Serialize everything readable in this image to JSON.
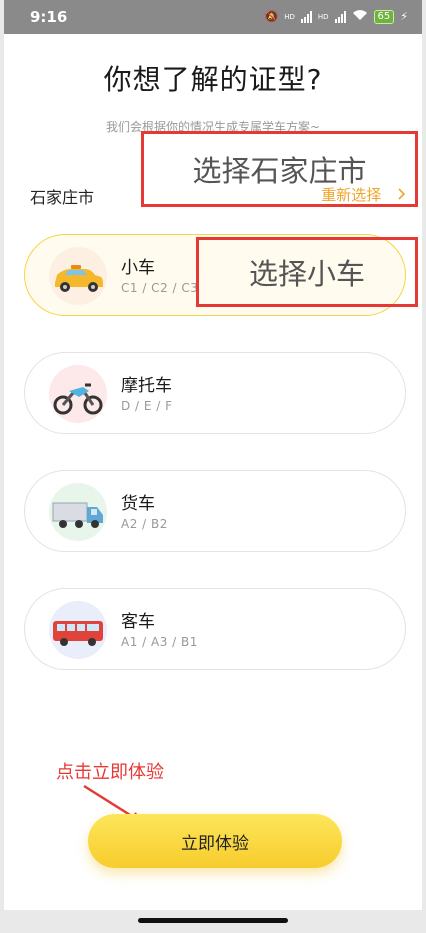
{
  "status_bar": {
    "time": "9:16",
    "battery": "65",
    "network_labels": [
      "HD",
      "HD"
    ]
  },
  "page": {
    "title": "你想了解的证型?",
    "subtitle": "我们会根据你的情况生成专属学车方案~"
  },
  "city": {
    "name": "石家庄市",
    "reselect_label": "重新选择",
    "reselect_icon": "chevron-right-icon"
  },
  "vehicles": [
    {
      "name": "小车",
      "licenses": "C1 / C2 / C3",
      "icon": "car-icon",
      "selected": true,
      "icon_bg": "#fdf0e2"
    },
    {
      "name": "摩托车",
      "licenses": "D / E / F",
      "icon": "motorcycle-icon",
      "selected": false,
      "icon_bg": "#fde8ea"
    },
    {
      "name": "货车",
      "licenses": "A2 / B2",
      "icon": "truck-icon",
      "selected": false,
      "icon_bg": "#e8f5ea"
    },
    {
      "name": "客车",
      "licenses": "A1 / A3 / B1",
      "icon": "bus-icon",
      "selected": false,
      "icon_bg": "#eaeefa"
    }
  ],
  "annotations": {
    "city_box": "选择石家庄市",
    "car_box": "选择小车",
    "cta_tip": "点击立即体验"
  },
  "cta": {
    "label": "立即体验"
  },
  "colors": {
    "accent_yellow": "#f7cc2d",
    "reselect_orange": "#f0a52a",
    "annotation_red": "#e53935",
    "selected_border": "#f3d548"
  }
}
